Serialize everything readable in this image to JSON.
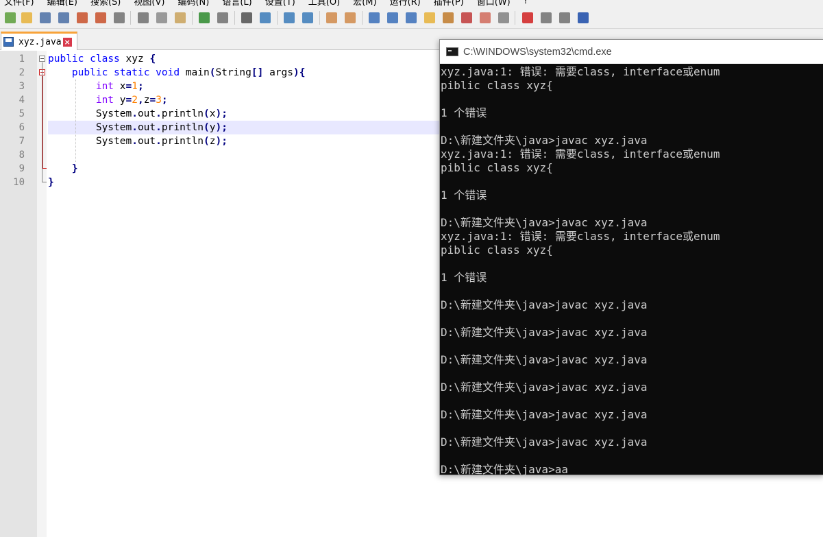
{
  "menu": [
    "文件(F)",
    "编辑(E)",
    "搜索(S)",
    "视图(V)",
    "编码(N)",
    "语言(L)",
    "设置(T)",
    "工具(O)",
    "宏(M)",
    "运行(R)",
    "插件(P)",
    "窗口(W)",
    "?"
  ],
  "toolbar": {
    "icons": [
      "new-file-icon",
      "open-file-icon",
      "save-icon",
      "save-all-icon",
      "close-icon",
      "close-all-icon",
      "print-icon",
      "cut-icon",
      "copy-icon",
      "paste-icon",
      "undo-icon",
      "redo-icon",
      "find-icon",
      "replace-icon",
      "zoom-in-icon",
      "zoom-out-icon",
      "sync-vertical-icon",
      "sync-horizontal-icon",
      "word-wrap-icon",
      "show-all-chars-icon",
      "indent-guide-icon",
      "doc-map-icon",
      "function-list-icon",
      "folder-workspace-icon",
      "monitoring-icon",
      "record-macro-icon",
      "stop-record-icon",
      "play-macro-icon",
      "run-macro-multiple-icon",
      "save-macro-icon"
    ]
  },
  "tab": {
    "label": "xyz.java"
  },
  "editor": {
    "line_numbers": [
      "1",
      "2",
      "3",
      "4",
      "5",
      "6",
      "7",
      "8",
      "9",
      "10"
    ],
    "lines": [
      [
        [
          "kw",
          "public"
        ],
        [
          "pl",
          " "
        ],
        [
          "kw",
          "class"
        ],
        [
          "pl",
          " xyz "
        ],
        [
          "op",
          "{"
        ]
      ],
      [
        [
          "pl",
          "    "
        ],
        [
          "kw",
          "public"
        ],
        [
          "pl",
          " "
        ],
        [
          "kw",
          "static"
        ],
        [
          "pl",
          " "
        ],
        [
          "kw",
          "void"
        ],
        [
          "pl",
          " main"
        ],
        [
          "op",
          "("
        ],
        [
          "pl",
          "String"
        ],
        [
          "op",
          "[]"
        ],
        [
          "pl",
          " args"
        ],
        [
          "op",
          ")"
        ],
        [
          "op",
          "{"
        ]
      ],
      [
        [
          "pl",
          "        "
        ],
        [
          "kw2",
          "int"
        ],
        [
          "pl",
          " x"
        ],
        [
          "op",
          "="
        ],
        [
          "num",
          "1"
        ],
        [
          "op",
          ";"
        ]
      ],
      [
        [
          "pl",
          "        "
        ],
        [
          "kw2",
          "int"
        ],
        [
          "pl",
          " y"
        ],
        [
          "op",
          "="
        ],
        [
          "num",
          "2"
        ],
        [
          "op",
          ","
        ],
        [
          "pl",
          "z"
        ],
        [
          "op",
          "="
        ],
        [
          "num",
          "3"
        ],
        [
          "op",
          ";"
        ]
      ],
      [
        [
          "pl",
          "        System"
        ],
        [
          "op",
          "."
        ],
        [
          "pl",
          "out"
        ],
        [
          "op",
          "."
        ],
        [
          "pl",
          "println"
        ],
        [
          "op",
          "("
        ],
        [
          "pl",
          "x"
        ],
        [
          "op",
          ")"
        ],
        [
          "op",
          ";"
        ]
      ],
      [
        [
          "pl",
          "        System"
        ],
        [
          "op",
          "."
        ],
        [
          "pl",
          "out"
        ],
        [
          "op",
          "."
        ],
        [
          "pl",
          "println"
        ],
        [
          "op",
          "("
        ],
        [
          "pl",
          "y"
        ],
        [
          "op",
          ")"
        ],
        [
          "op",
          ";"
        ]
      ],
      [
        [
          "pl",
          "        System"
        ],
        [
          "op",
          "."
        ],
        [
          "pl",
          "out"
        ],
        [
          "op",
          "."
        ],
        [
          "pl",
          "println"
        ],
        [
          "op",
          "("
        ],
        [
          "pl",
          "z"
        ],
        [
          "op",
          ")"
        ],
        [
          "op",
          ";"
        ]
      ],
      [
        [
          "pl",
          ""
        ]
      ],
      [
        [
          "pl",
          "    "
        ],
        [
          "op",
          "}"
        ]
      ],
      [
        [
          "op",
          "}"
        ]
      ]
    ]
  },
  "cmd": {
    "title": "C:\\WINDOWS\\system32\\cmd.exe",
    "lines": [
      "xyz.java:1: 错误: 需要class, interface或enum",
      "piblic class xyz{",
      "",
      "1 个错误",
      "",
      "D:\\新建文件夹\\java>javac xyz.java",
      "xyz.java:1: 错误: 需要class, interface或enum",
      "piblic class xyz{",
      "",
      "1 个错误",
      "",
      "D:\\新建文件夹\\java>javac xyz.java",
      "xyz.java:1: 错误: 需要class, interface或enum",
      "piblic class xyz{",
      "",
      "1 个错误",
      "",
      "D:\\新建文件夹\\java>javac xyz.java",
      "",
      "D:\\新建文件夹\\java>javac xyz.java",
      "",
      "D:\\新建文件夹\\java>javac xyz.java",
      "",
      "D:\\新建文件夹\\java>javac xyz.java",
      "",
      "D:\\新建文件夹\\java>javac xyz.java",
      "",
      "D:\\新建文件夹\\java>javac xyz.java",
      "",
      "D:\\新建文件夹\\java>aa"
    ]
  }
}
